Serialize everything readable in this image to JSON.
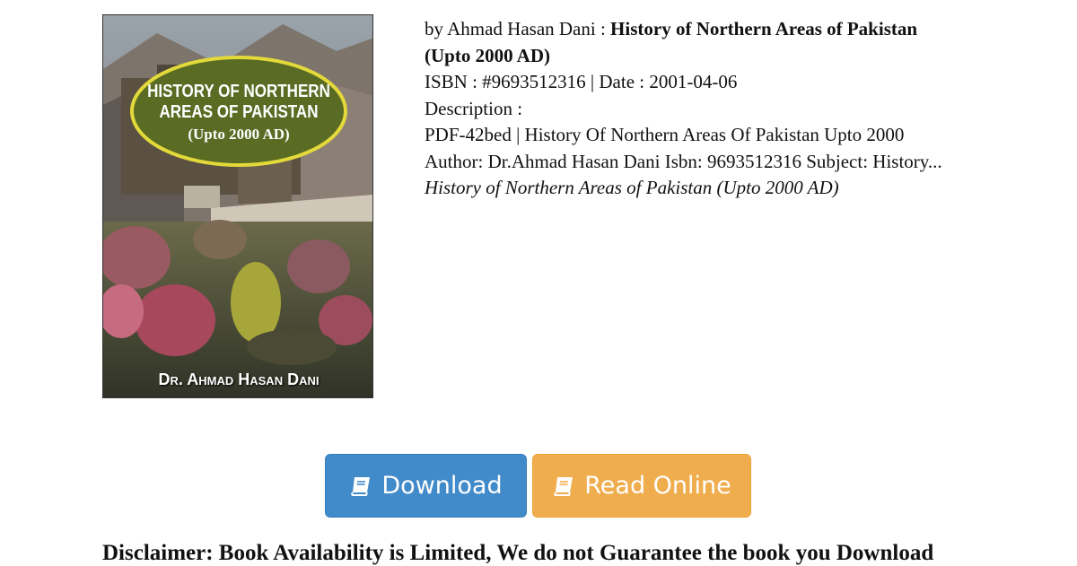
{
  "cover": {
    "title_line1": "HISTORY OF NORTHERN",
    "title_line2": "AREAS OF PAKISTAN",
    "subtitle": "(Upto 2000 AD)",
    "author": "Dr. Ahmad Hasan Dani",
    "oval_color": "#5a6b24",
    "oval_border_color": "#e3d93a"
  },
  "book": {
    "by_prefix": "by Ahmad Hasan Dani : ",
    "title_bold": "History of Northern Areas of Pakistan",
    "title_bold_2": "(Upto 2000 AD)",
    "isbn_line": "ISBN : #9693512316 | Date : 2001-04-06",
    "description_label": "Description :",
    "description_line1": "PDF-42bed | History Of Northern Areas Of Pakistan Upto 2000",
    "description_line2": "Author: Dr.Ahmad Hasan Dani Isbn: 9693512316 Subject: History...",
    "title_italic": "History of Northern Areas of Pakistan (Upto 2000 AD)"
  },
  "buttons": {
    "download_label": "Download",
    "read_online_label": "Read Online",
    "download_color": "#428bca",
    "read_online_color": "#f0ad4e",
    "icon": "book-icon"
  },
  "disclaimer": "Disclaimer: Book Availability is Limited, We do not Guarantee the book you Download"
}
